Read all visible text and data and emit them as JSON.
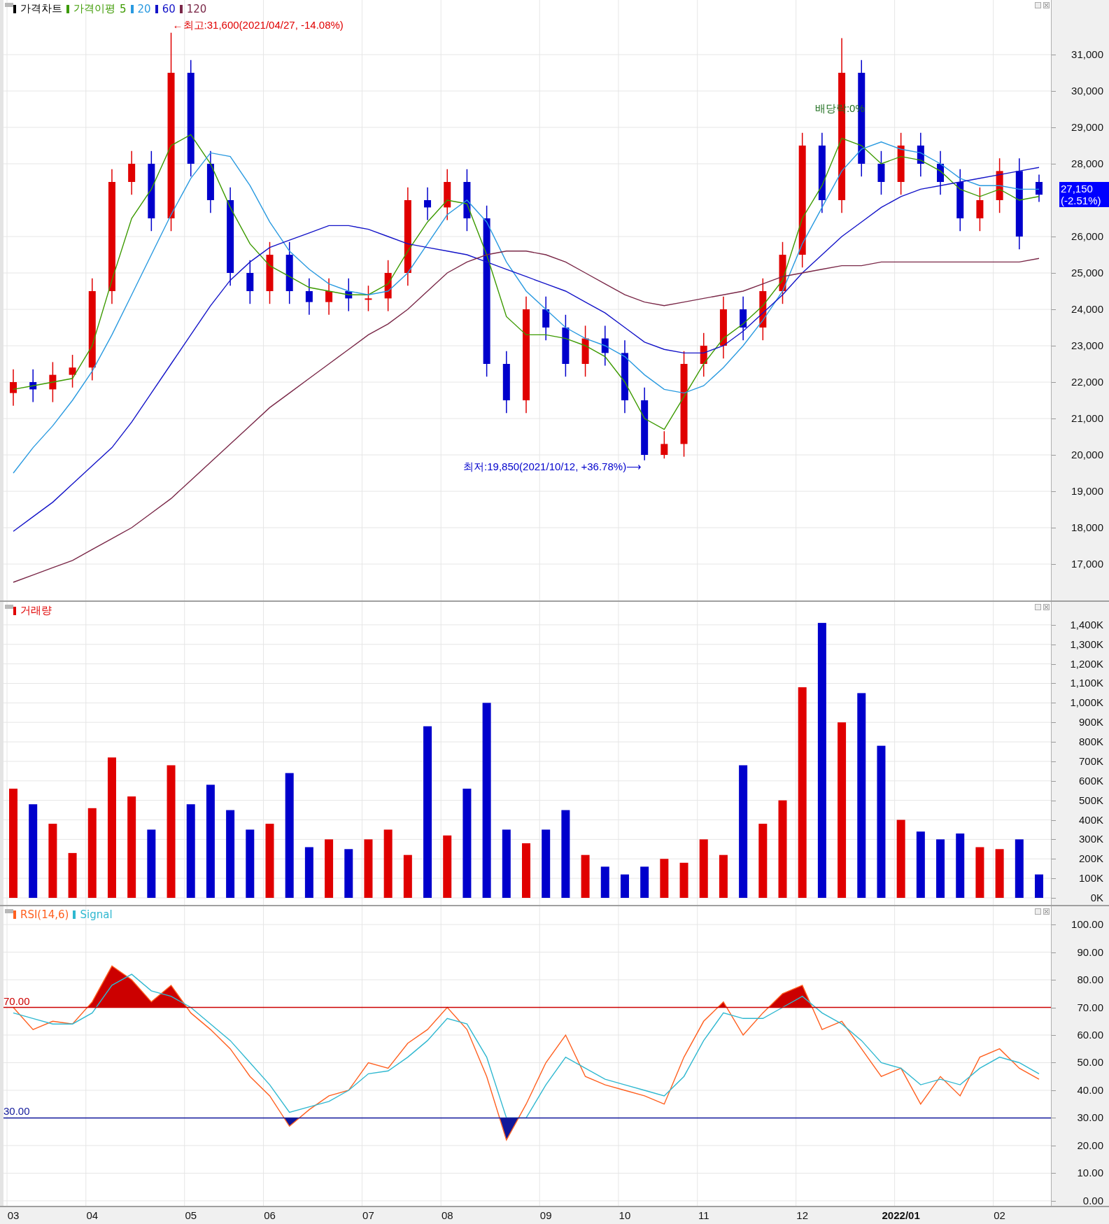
{
  "price_panel": {
    "legend_label": "가격차트",
    "current_price": {
      "value": "27,150",
      "change": "(-2.51%)"
    },
    "chart_data": {
      "type": "candlestick",
      "grid": true,
      "ylim": [
        16000,
        32500
      ],
      "ohlc": [
        [
          21700,
          22350,
          21350,
          22000
        ],
        [
          22000,
          22350,
          21450,
          21800
        ],
        [
          21800,
          22550,
          21450,
          22200
        ],
        [
          22200,
          22750,
          21850,
          22400
        ],
        [
          22400,
          24850,
          22050,
          24500
        ],
        [
          24500,
          27850,
          24150,
          27500
        ],
        [
          27500,
          28350,
          27150,
          28000
        ],
        [
          28000,
          28350,
          26150,
          26500
        ],
        [
          26500,
          31600,
          26150,
          30500
        ],
        [
          30500,
          30850,
          27650,
          28000
        ],
        [
          28000,
          28350,
          26650,
          27000
        ],
        [
          27000,
          27350,
          24650,
          25000
        ],
        [
          25000,
          25350,
          24150,
          24500
        ],
        [
          24500,
          25850,
          24150,
          25500
        ],
        [
          25500,
          25850,
          24150,
          24500
        ],
        [
          24500,
          24850,
          23850,
          24200
        ],
        [
          24200,
          24850,
          23850,
          24500
        ],
        [
          24500,
          24850,
          23950,
          24300
        ],
        [
          24300,
          24650,
          23950,
          24300
        ],
        [
          24300,
          25350,
          23950,
          25000
        ],
        [
          25000,
          27350,
          24650,
          27000
        ],
        [
          27000,
          27350,
          26450,
          26800
        ],
        [
          26800,
          27850,
          26450,
          27500
        ],
        [
          27500,
          27850,
          26150,
          26500
        ],
        [
          26500,
          26850,
          22150,
          22500
        ],
        [
          22500,
          22850,
          21150,
          21500
        ],
        [
          21500,
          24350,
          21150,
          24000
        ],
        [
          24000,
          24350,
          23150,
          23500
        ],
        [
          23500,
          23850,
          22150,
          22500
        ],
        [
          22500,
          23550,
          22150,
          23200
        ],
        [
          23200,
          23550,
          22450,
          22800
        ],
        [
          22800,
          23150,
          21150,
          21500
        ],
        [
          21500,
          21850,
          19850,
          20000
        ],
        [
          20000,
          20650,
          19900,
          20300
        ],
        [
          20300,
          22850,
          19950,
          22500
        ],
        [
          22500,
          23350,
          22150,
          23000
        ],
        [
          23000,
          24350,
          22650,
          24000
        ],
        [
          24000,
          24350,
          23150,
          23500
        ],
        [
          23500,
          24850,
          23150,
          24500
        ],
        [
          24500,
          25850,
          24150,
          25500
        ],
        [
          25500,
          28850,
          25150,
          28500
        ],
        [
          28500,
          28850,
          26650,
          27000
        ],
        [
          27000,
          31450,
          26650,
          30500
        ],
        [
          30500,
          30850,
          27650,
          28000
        ],
        [
          28000,
          28350,
          27150,
          27500
        ],
        [
          27500,
          28850,
          27150,
          28500
        ],
        [
          28500,
          28850,
          27650,
          28000
        ],
        [
          28000,
          28350,
          27150,
          27500
        ],
        [
          27500,
          27850,
          26150,
          26500
        ],
        [
          26500,
          27350,
          26150,
          27000
        ],
        [
          27000,
          28150,
          26650,
          27800
        ],
        [
          27800,
          28150,
          25650,
          26000
        ],
        [
          27500,
          27700,
          26950,
          27150
        ]
      ],
      "annotations": [
        "←최고:31,600(2021/04/27, -14.08%)",
        "최저:19,850(2021/10/12, +36.78%)⟶",
        "배당락:0%"
      ]
    },
    "moving_averages": {
      "label": "가격이평",
      "chart_data": {
        "type": "line",
        "ylim": [
          16000,
          32500
        ],
        "yticks": [
          {
            "value": 17000,
            "label": "17,000"
          },
          {
            "value": 18000,
            "label": "18,000"
          },
          {
            "value": 19000,
            "label": "19,000"
          },
          {
            "value": 20000,
            "label": "20,000"
          },
          {
            "value": 21000,
            "label": "21,000"
          },
          {
            "value": 22000,
            "label": "22,000"
          },
          {
            "value": 23000,
            "label": "23,000"
          },
          {
            "value": 24000,
            "label": "24,000"
          },
          {
            "value": 25000,
            "label": "25,000"
          },
          {
            "value": 26000,
            "label": "26,000"
          },
          {
            "value": 28000,
            "label": "28,000"
          },
          {
            "value": 29000,
            "label": "29,000"
          },
          {
            "value": 30000,
            "label": "30,000"
          },
          {
            "value": 31000,
            "label": "31,000"
          }
        ],
        "series": [
          {
            "name": "5",
            "color": "#3c9a00",
            "values": [
              21800,
              21900,
              22000,
              22100,
              23000,
              24800,
              26500,
              27300,
              28500,
              28800,
              28000,
              26800,
              25800,
              25200,
              24900,
              24600,
              24500,
              24400,
              24400,
              24700,
              25600,
              26400,
              27000,
              26900,
              25500,
              23800,
              23300,
              23300,
              23200,
              23000,
              22700,
              22000,
              21000,
              20700,
              21600,
              22500,
              23200,
              23600,
              24100,
              24800,
              26500,
              27400,
              28700,
              28500,
              28000,
              28200,
              28100,
              27800,
              27300,
              27100,
              27300,
              27000,
              27100
            ]
          },
          {
            "name": "20",
            "color": "#2a9ae0",
            "values": [
              19500,
              20200,
              20800,
              21500,
              22300,
              23300,
              24400,
              25500,
              26600,
              27600,
              28300,
              28200,
              27400,
              26400,
              25600,
              25100,
              24700,
              24500,
              24400,
              24500,
              25000,
              25800,
              26600,
              27000,
              26400,
              25300,
              24500,
              24000,
              23500,
              23200,
              23000,
              22700,
              22200,
              21800,
              21700,
              21900,
              22400,
              23000,
              23700,
              24500,
              25800,
              26800,
              27800,
              28400,
              28600,
              28400,
              28300,
              28000,
              27600,
              27400,
              27400,
              27300,
              27300
            ]
          },
          {
            "name": "60",
            "color": "#1414c8",
            "values": [
              17900,
              18300,
              18700,
              19200,
              19700,
              20200,
              20900,
              21700,
              22500,
              23300,
              24100,
              24800,
              25300,
              25700,
              25900,
              26100,
              26300,
              26300,
              26200,
              26000,
              25800,
              25700,
              25600,
              25500,
              25300,
              25100,
              24900,
              24700,
              24500,
              24200,
              23900,
              23500,
              23100,
              22900,
              22800,
              22800,
              23000,
              23400,
              23900,
              24400,
              25000,
              25500,
              26000,
              26400,
              26800,
              27100,
              27300,
              27400,
              27500,
              27600,
              27700,
              27800,
              27900
            ]
          },
          {
            "name": "120",
            "color": "#7a2848",
            "values": [
              16500,
              16700,
              16900,
              17100,
              17400,
              17700,
              18000,
              18400,
              18800,
              19300,
              19800,
              20300,
              20800,
              21300,
              21700,
              22100,
              22500,
              22900,
              23300,
              23600,
              24000,
              24500,
              25000,
              25300,
              25500,
              25600,
              25600,
              25500,
              25300,
              25000,
              24700,
              24400,
              24200,
              24100,
              24200,
              24300,
              24400,
              24500,
              24700,
              24900,
              25000,
              25100,
              25200,
              25200,
              25300,
              25300,
              25300,
              25300,
              25300,
              25300,
              25300,
              25300,
              25400
            ]
          }
        ]
      }
    }
  },
  "volume_panel": {
    "chart_data": {
      "type": "bar",
      "grid": true,
      "legend": "upper left",
      "ylim": [
        -36,
        1518
      ],
      "yticks": [
        {
          "value": 0,
          "label": "0K"
        },
        {
          "value": 100,
          "label": "100K"
        },
        {
          "value": 200,
          "label": "200K"
        },
        {
          "value": 300,
          "label": "300K"
        },
        {
          "value": 400,
          "label": "400K"
        },
        {
          "value": 500,
          "label": "500K"
        },
        {
          "value": 600,
          "label": "600K"
        },
        {
          "value": 700,
          "label": "700K"
        },
        {
          "value": 800,
          "label": "800K"
        },
        {
          "value": 900,
          "label": "900K"
        },
        {
          "value": 1000,
          "label": "1,000K"
        },
        {
          "value": 1100,
          "label": "1,100K"
        },
        {
          "value": 1200,
          "label": "1,200K"
        },
        {
          "value": 1300,
          "label": "1,300K"
        },
        {
          "value": 1400,
          "label": "1,400K"
        }
      ],
      "series": [
        {
          "name": "거래량",
          "color": "#e00000",
          "values": [
            560,
            null,
            380,
            230,
            460,
            720,
            520,
            null,
            680,
            null,
            null,
            null,
            null,
            380,
            null,
            null,
            300,
            null,
            300,
            350,
            220,
            null,
            320,
            null,
            null,
            null,
            280,
            null,
            null,
            220,
            null,
            null,
            null,
            200,
            180,
            300,
            220,
            null,
            380,
            500,
            1080,
            null,
            900,
            null,
            null,
            400,
            null,
            null,
            null,
            260,
            250,
            null,
            null
          ]
        },
        {
          "color": "#0000cc",
          "values": [
            null,
            480,
            null,
            null,
            null,
            null,
            null,
            350,
            null,
            480,
            580,
            450,
            350,
            null,
            640,
            260,
            null,
            250,
            null,
            null,
            null,
            880,
            null,
            560,
            1000,
            350,
            null,
            350,
            450,
            null,
            160,
            120,
            160,
            null,
            null,
            null,
            null,
            680,
            null,
            null,
            null,
            1410,
            null,
            1050,
            780,
            null,
            340,
            300,
            330,
            null,
            null,
            300,
            120
          ]
        }
      ]
    }
  },
  "rsi_panel": {
    "chart_data": {
      "type": "line",
      "grid": true,
      "legend": "upper left",
      "ylim": [
        -1.8,
        106.6
      ],
      "categories": [
        "03",
        null,
        null,
        null,
        "04",
        null,
        null,
        null,
        null,
        "05",
        null,
        null,
        null,
        "06",
        null,
        null,
        null,
        null,
        "07",
        null,
        null,
        null,
        "08",
        null,
        null,
        null,
        null,
        "09",
        null,
        null,
        null,
        "10",
        null,
        null,
        null,
        "11",
        null,
        null,
        null,
        null,
        "12",
        null,
        null,
        null,
        null,
        "2022/01",
        null,
        null,
        null,
        null,
        "02",
        null,
        null
      ],
      "yticks": [
        {
          "value": 0,
          "label": "0.00"
        },
        {
          "value": 10,
          "label": "10.00"
        },
        {
          "value": 20,
          "label": "20.00"
        },
        {
          "value": 30,
          "label": "30.00"
        },
        {
          "value": 40,
          "label": "40.00"
        },
        {
          "value": 50,
          "label": "50.00"
        },
        {
          "value": 60,
          "label": "60.00"
        },
        {
          "value": 70,
          "label": "70.00"
        },
        {
          "value": 80,
          "label": "80.00"
        },
        {
          "value": 90,
          "label": "90.00"
        },
        {
          "value": 100,
          "label": "100.00"
        }
      ],
      "series": [
        {
          "name": "RSI(14,6)",
          "color": "#ff6020",
          "values": [
            70,
            62,
            65,
            64,
            72,
            85,
            80,
            72,
            78,
            68,
            62,
            55,
            45,
            38,
            27,
            33,
            38,
            40,
            50,
            48,
            57,
            62,
            70,
            62,
            45,
            22,
            35,
            50,
            60,
            45,
            42,
            40,
            38,
            35,
            52,
            65,
            72,
            60,
            68,
            75,
            78,
            62,
            65,
            55,
            45,
            48,
            35,
            45,
            38,
            52,
            55,
            48,
            44
          ]
        },
        {
          "name": "Signal",
          "color": "#30b8d0",
          "values": [
            68,
            66,
            64,
            64,
            68,
            78,
            82,
            76,
            74,
            70,
            64,
            58,
            50,
            42,
            32,
            34,
            36,
            40,
            46,
            47,
            52,
            58,
            66,
            64,
            52,
            30,
            30,
            42,
            52,
            48,
            44,
            42,
            40,
            38,
            45,
            58,
            68,
            66,
            66,
            70,
            74,
            68,
            64,
            58,
            50,
            48,
            42,
            44,
            42,
            48,
            52,
            50,
            46
          ]
        }
      ],
      "ref_lines": [
        {
          "axis": "y",
          "value": 70,
          "label": "70.00",
          "color": "#cc0000"
        },
        {
          "axis": "y",
          "value": 30,
          "label": "30.00",
          "color": "#10189a"
        }
      ]
    }
  }
}
